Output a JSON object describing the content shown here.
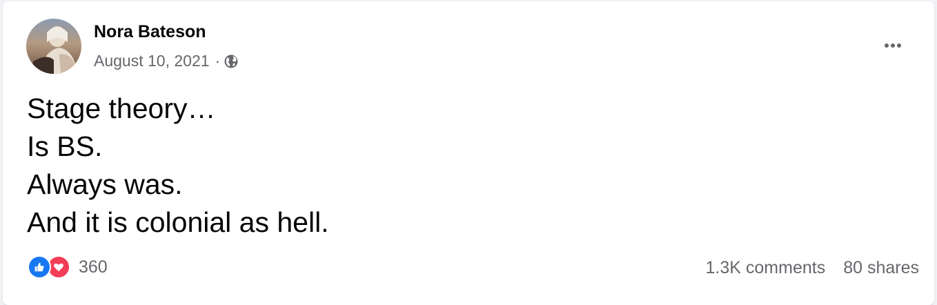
{
  "post": {
    "author": "Nora Bateson",
    "date": "August 10, 2021",
    "separator": "·",
    "privacy_icon": "globe-icon",
    "more_icon": "ellipsis-icon",
    "text_lines": [
      "Stage theory…",
      "Is BS.",
      "Always was.",
      "And it is colonial as hell."
    ]
  },
  "footer": {
    "reaction_icons": [
      "like-icon",
      "love-icon"
    ],
    "reaction_count": "360",
    "comments": "1.3K comments",
    "shares": "80 shares"
  },
  "colors": {
    "like": "#1877f2",
    "love": "#f33e58",
    "secondary_text": "#65676b",
    "primary_text": "#050505"
  }
}
